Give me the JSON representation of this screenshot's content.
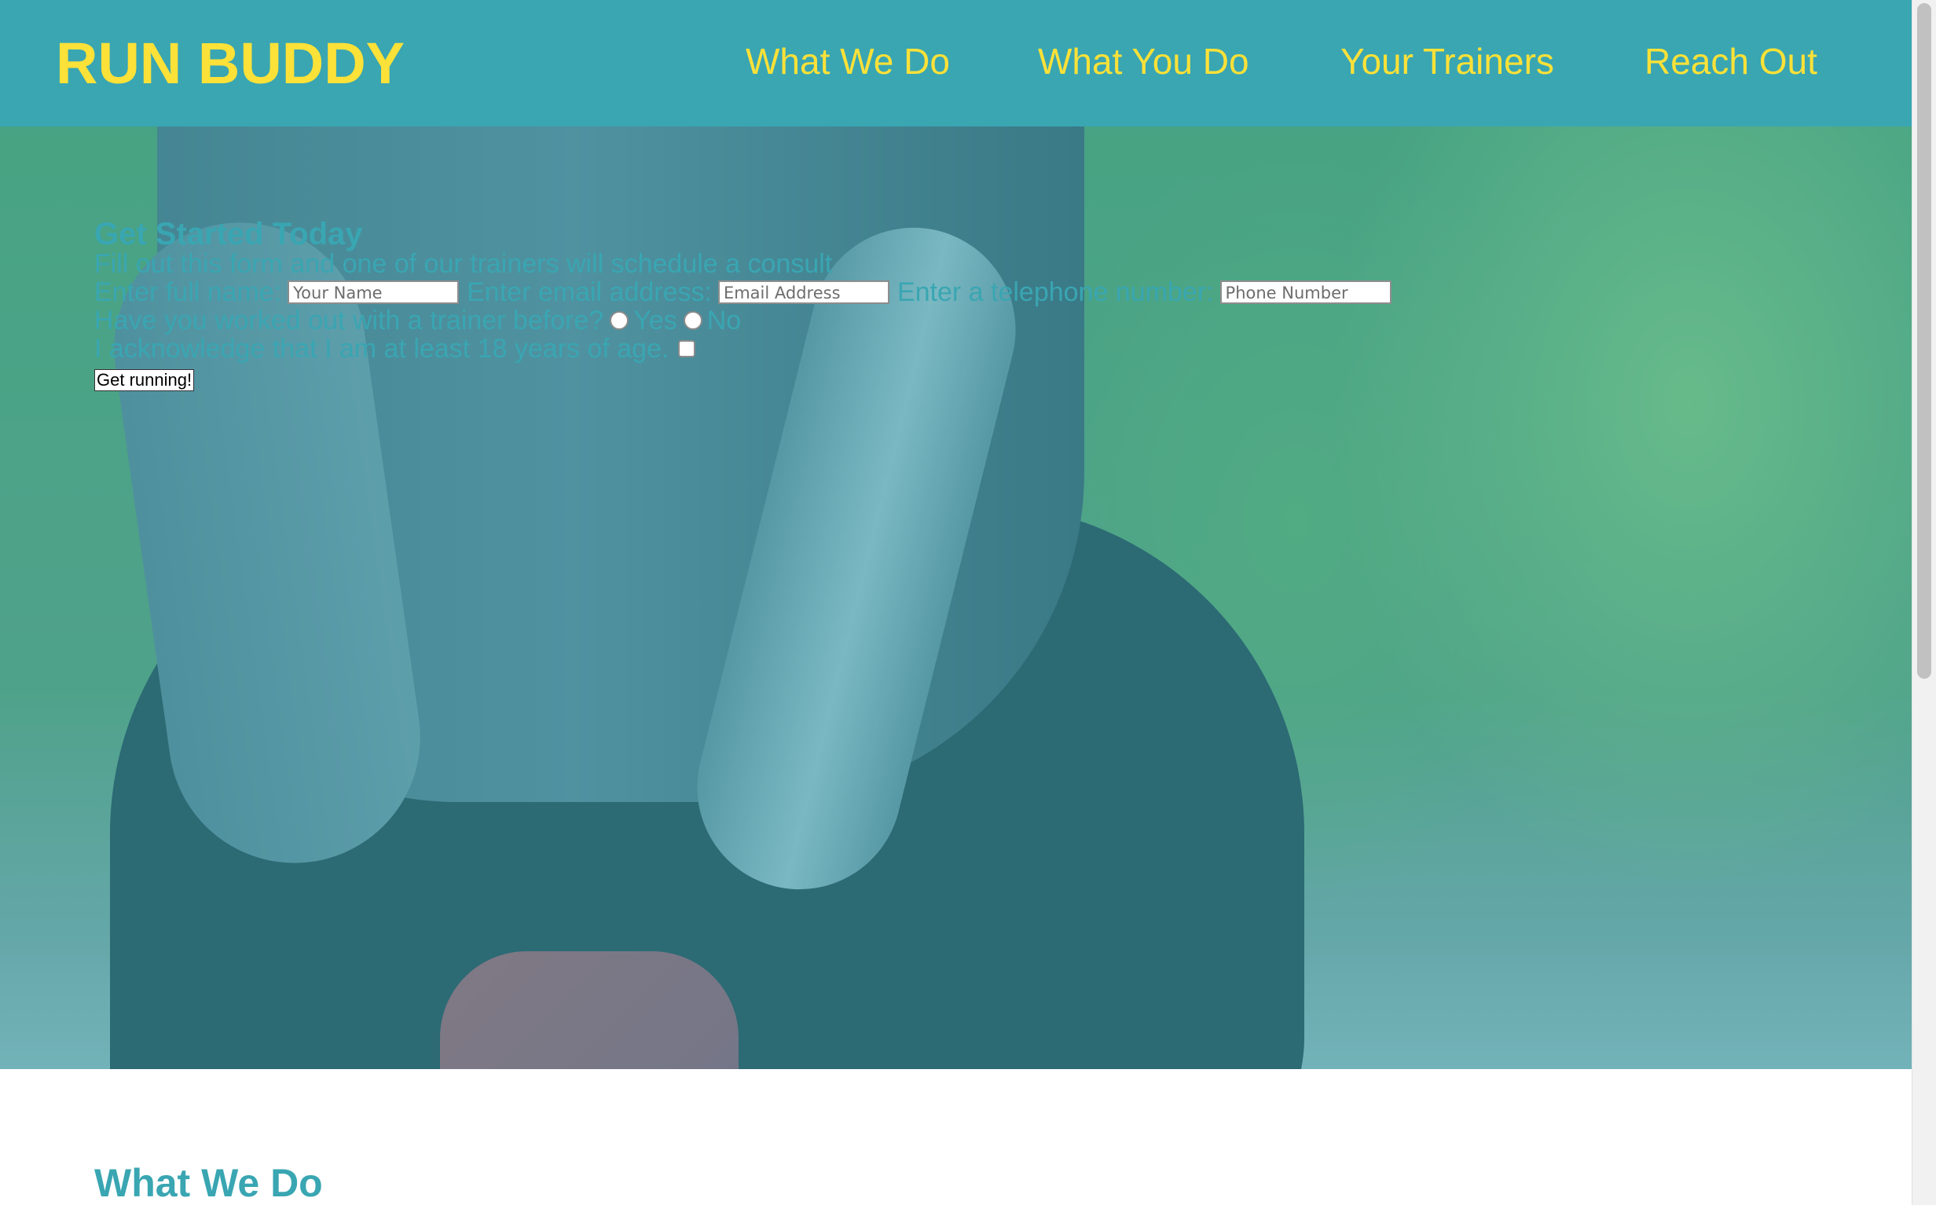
{
  "header": {
    "logo": "RUN BUDDY",
    "nav": [
      {
        "label": "What We Do"
      },
      {
        "label": "What You Do"
      },
      {
        "label": "Your Trainers"
      },
      {
        "label": "Reach Out"
      }
    ]
  },
  "form": {
    "title": "Get Started Today",
    "subtitle": "Fill out this form and one of our trainers will schedule a consult",
    "name_label": "Enter full name:",
    "name_placeholder": "Your Name",
    "email_label": "Enter email address:",
    "email_placeholder": "Email Address",
    "phone_label": "Enter a telephone number:",
    "phone_placeholder": "Phone Number",
    "trainer_question": "Have you worked out with a trainer before?",
    "yes_label": "Yes",
    "no_label": "No",
    "age_ack": "I acknowledge that I am at least 18 years of age.",
    "submit_label": "Get running!"
  },
  "sections": {
    "what_we_do_title": "What We Do"
  },
  "colors": {
    "brand_primary": "#39a6b2",
    "brand_accent": "#fce138"
  }
}
